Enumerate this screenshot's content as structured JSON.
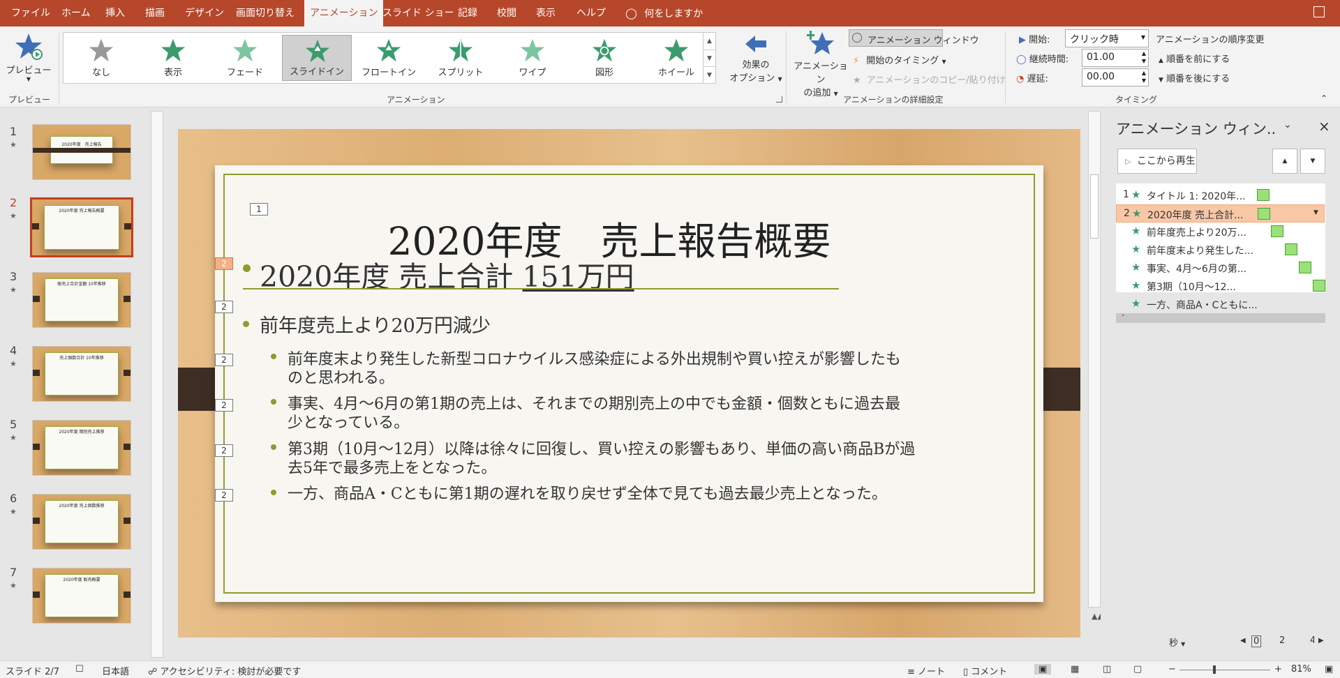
{
  "tabs": [
    {
      "label": "ファイル"
    },
    {
      "label": "ホーム"
    },
    {
      "label": "挿入"
    },
    {
      "label": "描画"
    },
    {
      "label": "デザイン"
    },
    {
      "label": "画面切り替え"
    },
    {
      "label": "アニメーション"
    },
    {
      "label": "スライド ショー"
    },
    {
      "label": "記録"
    },
    {
      "label": "校閲"
    },
    {
      "label": "表示"
    },
    {
      "label": "ヘルプ"
    }
  ],
  "tell_me": "何をしますか",
  "ribbon": {
    "preview_label": "プレビュー",
    "preview_group": "プレビュー",
    "gallery": [
      {
        "label": "なし"
      },
      {
        "label": "表示"
      },
      {
        "label": "フェード"
      },
      {
        "label": "スライドイン"
      },
      {
        "label": "フロートイン"
      },
      {
        "label": "スプリット"
      },
      {
        "label": "ワイプ"
      },
      {
        "label": "図形"
      },
      {
        "label": "ホイール"
      }
    ],
    "effect_options": "効果の\nオプション",
    "effect_options_l1": "効果の",
    "effect_options_l2": "オプション",
    "animation_group": "アニメーション",
    "add_animation_l1": "アニメーション",
    "add_animation_l2": "の追加",
    "animation_pane_btn": "アニメーション ウィンドウ",
    "trigger": "開始のタイミング",
    "painter": "アニメーションのコピー/貼り付け",
    "advanced_group": "アニメーションの詳細設定",
    "start_label": "開始:",
    "start_value": "クリック時",
    "duration_label": "継続時間:",
    "duration_value": "01.00",
    "delay_label": "遅延:",
    "delay_value": "00.00",
    "reorder_label": "アニメーションの順序変更",
    "move_earlier": "順番を前にする",
    "move_later": "順番を後にする",
    "timing_group": "タイミング"
  },
  "thumbnails": [
    {
      "num": "1",
      "star": "★",
      "title": "2020年度　売上報告"
    },
    {
      "num": "2",
      "star": "★",
      "title": "2020年度 売上報告概要"
    },
    {
      "num": "3",
      "star": "★",
      "title": "販売上合計金額 10年推移"
    },
    {
      "num": "4",
      "star": "★",
      "title": "売上個数合計 10年推移"
    },
    {
      "num": "5",
      "star": "★",
      "title": "2020年度 期別売上推移"
    },
    {
      "num": "6",
      "star": "★",
      "title": "2020年度 売上個数推移"
    },
    {
      "num": "7",
      "star": "★",
      "title": "2020年度 販売概要"
    }
  ],
  "slide": {
    "title": "2020年度　売上報告概要",
    "tag1": "1",
    "tag2": "2",
    "b1_prefix": "2020年度 売上合計 ",
    "b1_amount": "151万円",
    "b2": "前年度売上より20万円減少",
    "s1_l1": "前年度末より発生した新型コロナウイルス感染症による外出規制や買い控えが影響したも",
    "s1_l2": "のと思われる。",
    "s2_l1": "事実、4月～6月の第1期の売上は、それまでの期別売上の中でも金額・個数ともに過去最",
    "s2_l2": "少となっている。",
    "s3_l1": "第3期（10月～12月）以降は徐々に回復し、買い控えの影響もあり、単価の高い商品Bが過",
    "s3_l2": "去5年で最多売上をとなった。",
    "s4_l1": "一方、商品A・Cともに第1期の遅れを取り戻せず全体で見ても過去最少売上となった。"
  },
  "anim_pane": {
    "title": "アニメーション ウィン..",
    "play_from": "ここから再生",
    "items": [
      {
        "num": "1",
        "label": "タイトル 1: 2020年..."
      },
      {
        "num": "2",
        "label": "2020年度 売上合計..."
      },
      {
        "num": "",
        "label": "前年度売上より20万..."
      },
      {
        "num": "",
        "label": "前年度末より発生した..."
      },
      {
        "num": "",
        "label": "事実、4月～6月の第..."
      },
      {
        "num": "",
        "label": "第3期（10月～12..."
      },
      {
        "num": "",
        "label": "一方、商品A・Cともに..."
      }
    ],
    "seconds": "秒",
    "tl_0": "0",
    "tl_2": "2",
    "tl_4": "4"
  },
  "status": {
    "slide": "スライド 2/7",
    "lang": "日本語",
    "access": "アクセシビリティ: 検討が必要です",
    "notes": "ノート",
    "comments": "コメント",
    "zoom": "81%"
  },
  "colors": {
    "accent": "#b7472a",
    "slide_green": "#8c9c2e",
    "pane_sel": "#f8c7a6"
  }
}
